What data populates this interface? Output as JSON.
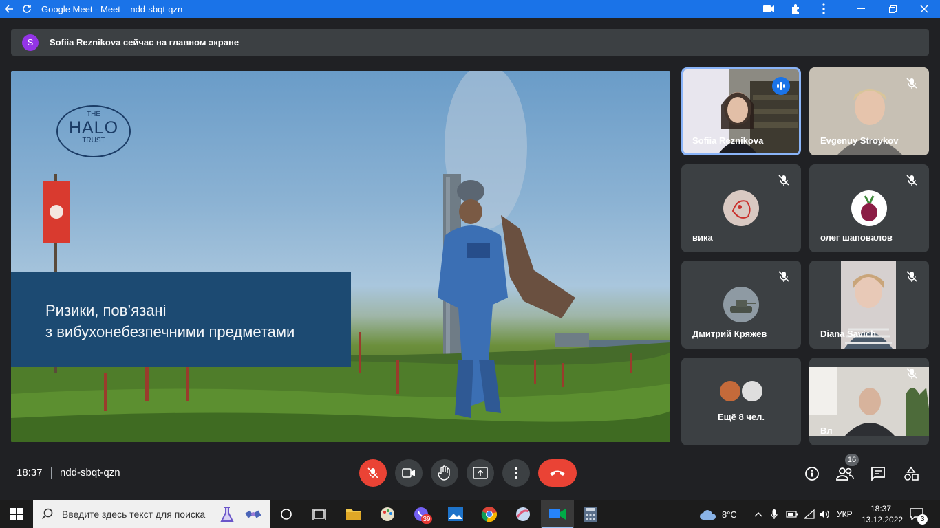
{
  "window": {
    "title": "Google Meet - Meet – ndd-sbqt-qzn"
  },
  "banner": {
    "avatar_letter": "S",
    "text": "Sofiia Reznikova сейчас на главном экране"
  },
  "slide": {
    "logo_top": "THE",
    "logo_main": "HALO",
    "logo_bottom": "TRUST",
    "line1": "Ризики, пов’язані",
    "line2": "з вибухонебезпечними предметами"
  },
  "participants": [
    {
      "name": "Sofiia Reznikova",
      "speaking": true
    },
    {
      "name": "Evgenuy Stroykov",
      "muted": true
    },
    {
      "name": "вика",
      "muted": true
    },
    {
      "name": "олег шаповалов",
      "muted": true
    },
    {
      "name": "Дмитрий Кряжев_",
      "muted": true
    },
    {
      "name": "Diana Savich",
      "muted": true
    },
    {
      "name": "Ещё 8 чел."
    },
    {
      "name": "Вл",
      "muted": true
    }
  ],
  "bottom": {
    "time": "18:37",
    "meeting_code": "ndd-sbqt-qzn",
    "people_count": "16"
  },
  "taskbar": {
    "search_placeholder": "Введите здесь текст для поиска",
    "viber_badge": "39",
    "weather": "8°C",
    "language": "УКР",
    "time": "18:37",
    "date": "13.12.2022",
    "notifications": "3"
  },
  "colors": {
    "titlebar": "#1a73e8",
    "meet_bg": "#202124",
    "tile_bg": "#3c4043",
    "end_call": "#ea4335",
    "slide_box": "#1c4a72",
    "speaking_border": "#8ab4f8"
  }
}
